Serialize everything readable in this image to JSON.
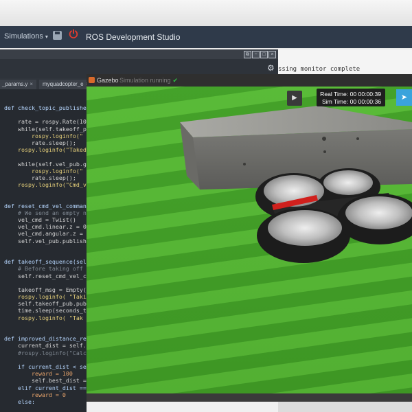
{
  "navbar": {
    "simulations_label": "Simulations",
    "caret": "▾",
    "power_glyph": "⏻",
    "app_title": "ROS Development Studio",
    "save_icon": "save-icon",
    "power_icon": "power-icon"
  },
  "editor": {
    "window_buttons": [
      "⧉",
      "−",
      "□",
      "×"
    ],
    "gear_glyph": "⚙",
    "tabs": [
      {
        "label": "_params.y",
        "close": "×"
      },
      {
        "label": "myquadcopter_e",
        "close": "×"
      }
    ],
    "lines": [
      {
        "t": "def check_topic_publishers",
        "kind": "def"
      },
      {
        "t": "",
        "kind": ""
      },
      {
        "t": "    rate = rospy.Rate(10",
        "kind": ""
      },
      {
        "t": "    while(self.takeoff_p",
        "kind": ""
      },
      {
        "t": "        rospy.loginfo(\"",
        "kind": "str"
      },
      {
        "t": "        rate.sleep();",
        "kind": ""
      },
      {
        "t": "    rospy.loginfo(\"Taked",
        "kind": "str"
      },
      {
        "t": "",
        "kind": ""
      },
      {
        "t": "    while(self.vel_pub.g",
        "kind": ""
      },
      {
        "t": "        rospy.loginfo(\"",
        "kind": "str"
      },
      {
        "t": "        rate.sleep();",
        "kind": ""
      },
      {
        "t": "    rospy.loginfo(\"Cmd_v",
        "kind": "str"
      },
      {
        "t": "",
        "kind": ""
      },
      {
        "t": "",
        "kind": ""
      },
      {
        "t": "def reset_cmd_vel_command",
        "kind": "def"
      },
      {
        "t": "    # We send an empty n",
        "kind": "cm"
      },
      {
        "t": "    vel_cmd = Twist()",
        "kind": ""
      },
      {
        "t": "    vel_cmd.linear.z = 0",
        "kind": ""
      },
      {
        "t": "    vel_cmd.angular.z = ",
        "kind": ""
      },
      {
        "t": "    self.vel_pub.publish",
        "kind": ""
      },
      {
        "t": "",
        "kind": ""
      },
      {
        "t": "",
        "kind": ""
      },
      {
        "t": "def takeoff_sequence(sel",
        "kind": "def"
      },
      {
        "t": "    # Before taking off",
        "kind": "cm"
      },
      {
        "t": "    self.reset_cmd_vel_c",
        "kind": ""
      },
      {
        "t": "",
        "kind": ""
      },
      {
        "t": "    takeoff_msg = Empty(",
        "kind": ""
      },
      {
        "t": "    rospy.loginfo( \"Taki",
        "kind": "str"
      },
      {
        "t": "    self.takeoff_pub.pub",
        "kind": ""
      },
      {
        "t": "    time.sleep(seconds_t",
        "kind": ""
      },
      {
        "t": "    rospy.loginfo( \"Tak",
        "kind": "str"
      },
      {
        "t": "",
        "kind": ""
      },
      {
        "t": "",
        "kind": ""
      },
      {
        "t": "def improved_distance_re",
        "kind": "def"
      },
      {
        "t": "    current_dist = self.",
        "kind": ""
      },
      {
        "t": "    #rospy.loginfo(\"Calc",
        "kind": "cm"
      },
      {
        "t": "",
        "kind": ""
      },
      {
        "t": "    if current_dist < se",
        "kind": "kw"
      },
      {
        "t": "        reward = 100",
        "kind": "num"
      },
      {
        "t": "        self.best_dist =",
        "kind": ""
      },
      {
        "t": "    elif current_dist ==",
        "kind": "kw"
      },
      {
        "t": "        reward = 0",
        "kind": "num"
      },
      {
        "t": "    else:",
        "kind": "kw"
      }
    ]
  },
  "terminal": {
    "text": "ssing monitor complete"
  },
  "gazebo": {
    "title": "Gazebo",
    "status": "Simulation running",
    "check": "✔",
    "play_glyph": "▶",
    "real_time": "Real Time: 00 00:00:39",
    "sim_time": "Sim Time: 00 00:00:36",
    "cursor_glyph": "➤",
    "colors": {
      "grass_light": "#5fc13b",
      "grass_dark": "#3f9a25",
      "wall": "#8a8a86",
      "drone_body": "#1e1e1e",
      "red_bar": "#d0201d",
      "accent_blue": "#3aa3dc"
    }
  }
}
